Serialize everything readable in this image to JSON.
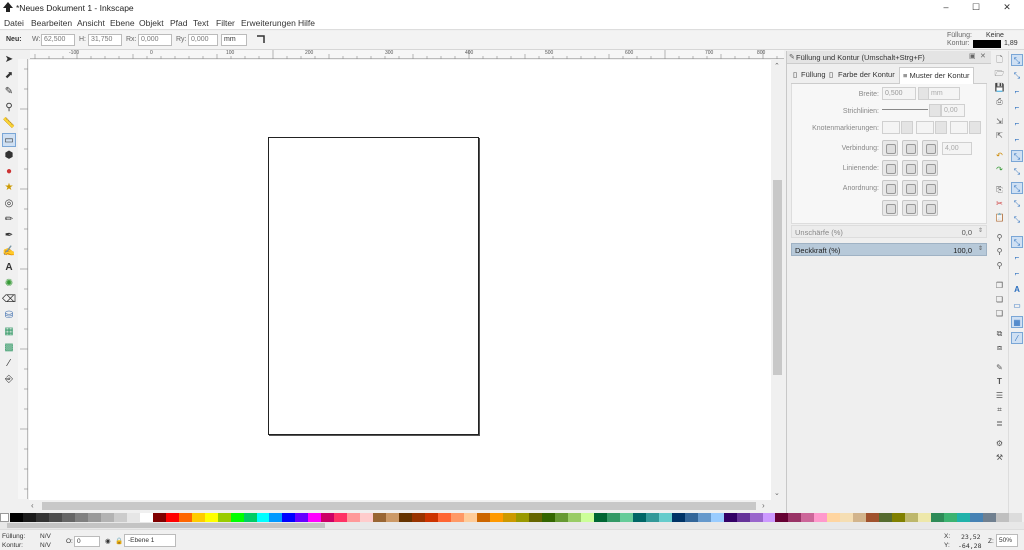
{
  "window": {
    "title": "*Neues Dokument 1 - Inkscape",
    "controls": [
      "–",
      "☐",
      "✕"
    ]
  },
  "menu": [
    "Datei",
    "Bearbeiten",
    "Ansicht",
    "Ebene",
    "Objekt",
    "Pfad",
    "Text",
    "Filter",
    "Erweiterungen",
    "Hilfe"
  ],
  "toolcontrols": {
    "neu_label": "Neu:",
    "w_label": "W:",
    "w_value": "62,500",
    "h_label": "H:",
    "h_value": "31,750",
    "rx_label": "Rx:",
    "rx_value": "0,000",
    "ry_label": "Ry:",
    "ry_value": "0,000",
    "unit": "mm"
  },
  "style_indicator": {
    "fill_label": "Füllung:",
    "fill_value": "Keine",
    "stroke_label": "Kontur:",
    "stroke_width": "1,89"
  },
  "ruler": {
    "top_labels": [
      "-100",
      "0",
      "100",
      "200",
      "300",
      "400",
      "500",
      "600",
      "700",
      "800"
    ]
  },
  "dock": {
    "title": "Füllung und Kontur (Umschalt+Strg+F)",
    "tabs": [
      "Füllung",
      "Farbe der Kontur",
      "Muster der Kontur"
    ],
    "active_tab": 2,
    "breite_label": "Breite:",
    "breite_value": "0,500",
    "breite_unit": "mm",
    "strichlinien_label": "Strichlinien:",
    "strichlinien_value": "0,00",
    "knoten_label": "Knotenmarkierungen:",
    "verbindung_label": "Verbindung:",
    "verbindung_value": "4,00",
    "linienende_label": "Linienende:",
    "anordnung_label": "Anordnung:",
    "unschaerfe_label": "Unschärfe (%)",
    "unschaerfe_value": "0,0",
    "deckkraft_label": "Deckkraft (%)",
    "deckkraft_value": "100,0"
  },
  "status": {
    "fill_label": "Füllung:",
    "fill_value": "N/V",
    "stroke_label": "Kontur:",
    "stroke_value": "N/V",
    "opacity_label": "O:",
    "opacity_value": "0",
    "layer": "-Ebene 1",
    "x_label": "X:",
    "x_value": "23,52",
    "y_label": "Y:",
    "y_value": "-64,28",
    "zoom_label": "Z:",
    "zoom_value": "50%"
  },
  "colors": {
    "accent": "#2b6fbf",
    "deckkraft_bar": "#b7c9d9"
  },
  "palette_colors": [
    "#000000",
    "#1a1a1a",
    "#333333",
    "#4d4d4d",
    "#666666",
    "#808080",
    "#999999",
    "#b3b3b3",
    "#cccccc",
    "#e6e6e6",
    "#ffffff",
    "#800000",
    "#ff0000",
    "#ff6600",
    "#ffcc00",
    "#ffff00",
    "#99cc00",
    "#00ff00",
    "#00cc66",
    "#00ffff",
    "#0099ff",
    "#0000ff",
    "#6600ff",
    "#ff00ff",
    "#cc0066",
    "#ff3366",
    "#ff9999",
    "#ffcccc",
    "#996633",
    "#cc9966",
    "#663300",
    "#993300",
    "#cc3300",
    "#ff6633",
    "#ff9966",
    "#ffcc99",
    "#cc6600",
    "#ff9900",
    "#cc9900",
    "#999900",
    "#666600",
    "#336600",
    "#669933",
    "#99cc66",
    "#ccff99",
    "#006633",
    "#339966",
    "#66cc99",
    "#006666",
    "#339999",
    "#66cccc",
    "#003366",
    "#336699",
    "#6699cc",
    "#99ccff",
    "#330066",
    "#663399",
    "#9966cc",
    "#cc99ff",
    "#660033",
    "#993366",
    "#cc6699",
    "#ff99cc",
    "#ffd5a0",
    "#f5deb3",
    "#d2b48c",
    "#a0522d",
    "#556b2f",
    "#808000",
    "#bdb76b",
    "#eee8aa",
    "#2e8b57",
    "#3cb371",
    "#20b2aa",
    "#4682b4",
    "#708090",
    "#c0c0c0",
    "#dcdcdc"
  ]
}
